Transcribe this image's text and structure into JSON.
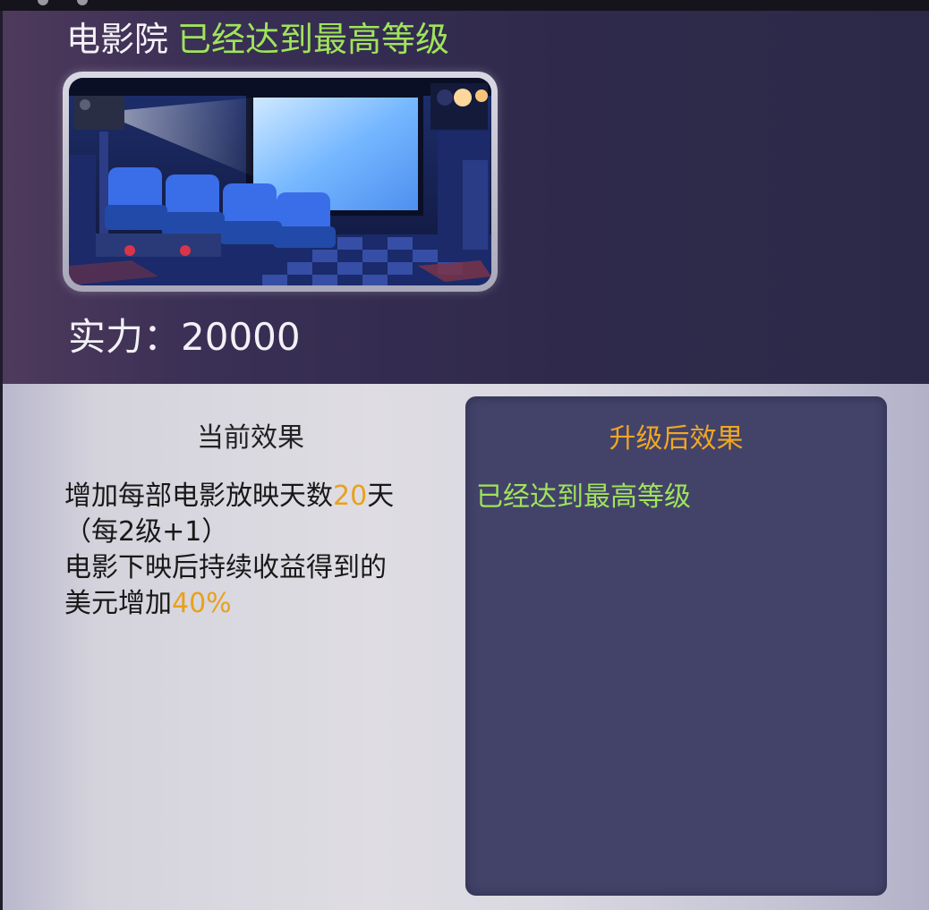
{
  "building": {
    "name": "电影院",
    "status": "已经达到最高等级",
    "power_label": "实力：",
    "power_value": "20000"
  },
  "current_effect": {
    "title": "当前效果",
    "line1_prefix": "增加每部电影放映天数",
    "line1_value": "20",
    "line1_suffix": "天",
    "line2": "（每2级+1）",
    "line3": "电影下映后持续收益得到的",
    "line4_prefix": "美元增加",
    "line4_value": "40%"
  },
  "upgrade_effect": {
    "title": "升级后效果",
    "text": "已经达到最高等级"
  },
  "colors": {
    "highlight_green": "#9fe45a",
    "highlight_orange": "#e8a11b",
    "panel_bg": "#43436a"
  },
  "icons": {
    "building_picture": "movie-theater-illustration"
  }
}
